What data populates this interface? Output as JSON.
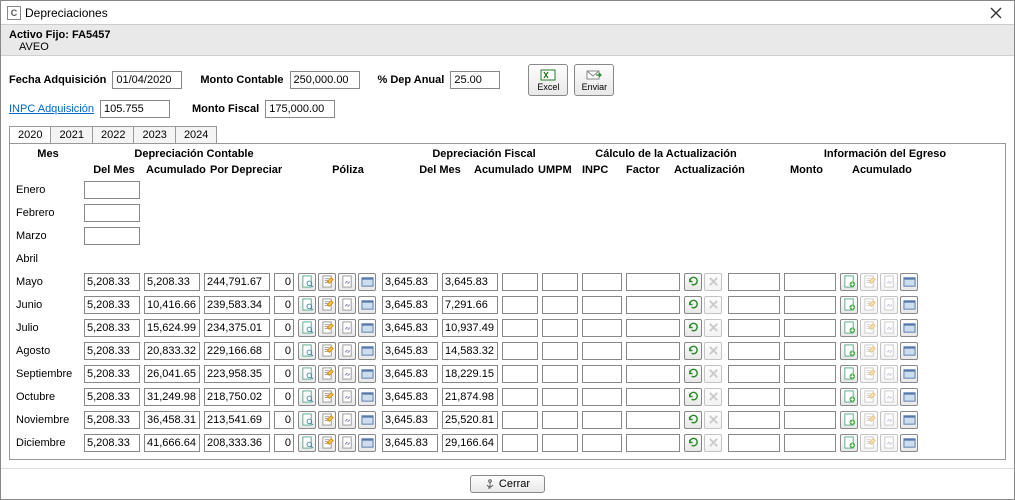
{
  "window": {
    "title": "Depreciaciones"
  },
  "asset": {
    "label": "Activo Fijo:",
    "code": "FA5457",
    "name": "AVEO"
  },
  "form": {
    "fecha_adq": {
      "label": "Fecha Adquisición",
      "value": "01/04/2020"
    },
    "monto_contable": {
      "label": "Monto Contable",
      "value": "250,000.00"
    },
    "dep_anual": {
      "label": "% Dep Anual",
      "value": "25.00"
    },
    "inpc_adq": {
      "label": "INPC Adquisición",
      "value": "105.755"
    },
    "monto_fiscal": {
      "label": "Monto Fiscal",
      "value": "175,000.00"
    }
  },
  "actions": {
    "excel": "Excel",
    "enviar": "Enviar"
  },
  "tabs": [
    "2020",
    "2021",
    "2022",
    "2023",
    "2024"
  ],
  "headers": {
    "groups": {
      "mes": "Mes",
      "dep_contable": "Depreciación Contable",
      "dep_fiscal": "Depreciación Fiscal",
      "calc_act": "Cálculo de la Actualización",
      "info_egreso": "Información del Egreso"
    },
    "sub": {
      "del_mes": "Del Mes",
      "acumulado": "Acumulado",
      "por_depreciar": "Por Depreciar",
      "poliza": "Póliza",
      "umpm": "UMPM",
      "inpc": "INPC",
      "factor": "Factor",
      "actualizacion": "Actualización",
      "monto": "Monto"
    }
  },
  "rows": [
    {
      "mes": "Enero",
      "empty": true
    },
    {
      "mes": "Febrero",
      "empty": true
    },
    {
      "mes": "Marzo",
      "empty": true
    },
    {
      "mes": "Abril",
      "empty": true,
      "noBox": true
    },
    {
      "mes": "Mayo",
      "del_mes": "5,208.33",
      "acum": "5,208.33",
      "por_dep": "244,791.67",
      "pol": "0",
      "f_del_mes": "3,645.83",
      "f_acum": "3,645.83"
    },
    {
      "mes": "Junio",
      "del_mes": "5,208.33",
      "acum": "10,416.66",
      "por_dep": "239,583.34",
      "pol": "0",
      "f_del_mes": "3,645.83",
      "f_acum": "7,291.66"
    },
    {
      "mes": "Julio",
      "del_mes": "5,208.33",
      "acum": "15,624.99",
      "por_dep": "234,375.01",
      "pol": "0",
      "f_del_mes": "3,645.83",
      "f_acum": "10,937.49"
    },
    {
      "mes": "Agosto",
      "del_mes": "5,208.33",
      "acum": "20,833.32",
      "por_dep": "229,166.68",
      "pol": "0",
      "f_del_mes": "3,645.83",
      "f_acum": "14,583.32"
    },
    {
      "mes": "Septiembre",
      "del_mes": "5,208.33",
      "acum": "26,041.65",
      "por_dep": "223,958.35",
      "pol": "0",
      "f_del_mes": "3,645.83",
      "f_acum": "18,229.15"
    },
    {
      "mes": "Octubre",
      "del_mes": "5,208.33",
      "acum": "31,249.98",
      "por_dep": "218,750.02",
      "pol": "0",
      "f_del_mes": "3,645.83",
      "f_acum": "21,874.98"
    },
    {
      "mes": "Noviembre",
      "del_mes": "5,208.33",
      "acum": "36,458.31",
      "por_dep": "213,541.69",
      "pol": "0",
      "f_del_mes": "3,645.83",
      "f_acum": "25,520.81"
    },
    {
      "mes": "Diciembre",
      "del_mes": "5,208.33",
      "acum": "41,666.64",
      "por_dep": "208,333.36",
      "pol": "0",
      "f_del_mes": "3,645.83",
      "f_acum": "29,166.64"
    }
  ],
  "footer": {
    "cerrar": "Cerrar"
  },
  "icons": {
    "poliza": [
      "doc-search-icon",
      "doc-edit-icon",
      "doc-link-icon",
      "doc-view-icon"
    ],
    "act": [
      "refresh-icon",
      "delete-icon"
    ],
    "egreso": [
      "doc-add-icon",
      "doc-edit-icon",
      "doc-link-icon",
      "doc-view-icon"
    ]
  }
}
